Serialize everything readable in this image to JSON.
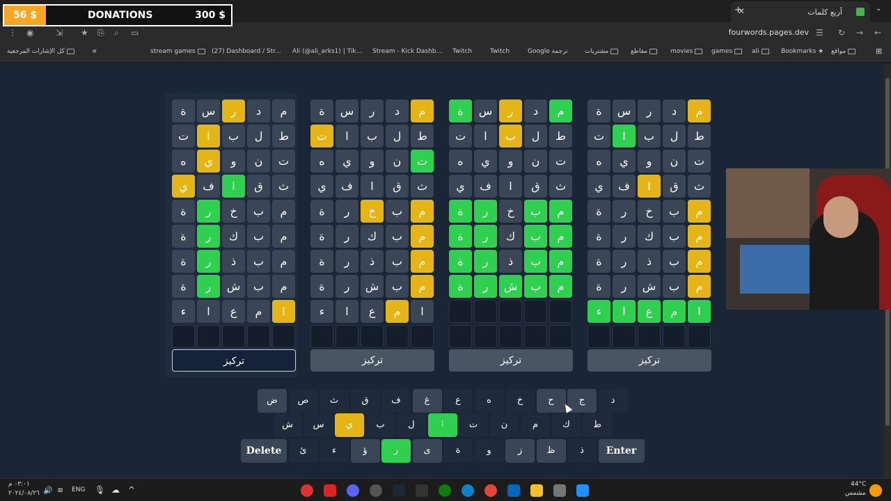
{
  "browser": {
    "tab_title": "أربع كلمات",
    "url": "fourwords.pages.dev",
    "new_tab": "+",
    "close": "✕",
    "bookmarks": [
      {
        "label": "مواقع"
      },
      {
        "label": "Bookmarks"
      },
      {
        "label": "ali"
      },
      {
        "label": "games"
      },
      {
        "label": "movies"
      },
      {
        "label": "مقاطع"
      },
      {
        "label": "مشتريات"
      },
      {
        "label": "Google ترجمة"
      },
      {
        "label": "Twitch"
      },
      {
        "label": "Twitch"
      },
      {
        "label": "Stream - Kick Dashb..."
      },
      {
        "label": "Ali (@ali_arks1) | Tik..."
      },
      {
        "label": "(27) Dashboard / Str..."
      },
      {
        "label": "stream games"
      }
    ],
    "all_bookmarks": "كل الإشارات المرجعية",
    "chevron": "«"
  },
  "donation": {
    "amount": "56 $",
    "label": "DONATIONS",
    "goal": "300 $"
  },
  "boards": [
    {
      "rows": [
        [
          [
            "ة",
            ""
          ],
          [
            "س",
            ""
          ],
          [
            "ر",
            "y"
          ],
          [
            "د",
            ""
          ],
          [
            "م",
            ""
          ]
        ],
        [
          [
            "ت",
            ""
          ],
          [
            "ا",
            "y"
          ],
          [
            "ب",
            ""
          ],
          [
            "ل",
            ""
          ],
          [
            "ط",
            ""
          ]
        ],
        [
          [
            "ه",
            ""
          ],
          [
            "ي",
            "y"
          ],
          [
            "و",
            ""
          ],
          [
            "ن",
            ""
          ],
          [
            "ت",
            ""
          ]
        ],
        [
          [
            "ي",
            "y"
          ],
          [
            "ف",
            ""
          ],
          [
            "ا",
            "g"
          ],
          [
            "ق",
            ""
          ],
          [
            "ث",
            ""
          ]
        ],
        [
          [
            "ة",
            ""
          ],
          [
            "ر",
            "g"
          ],
          [
            "خ",
            ""
          ],
          [
            "ب",
            ""
          ],
          [
            "م",
            ""
          ]
        ],
        [
          [
            "ة",
            ""
          ],
          [
            "ر",
            "g"
          ],
          [
            "ك",
            ""
          ],
          [
            "ب",
            ""
          ],
          [
            "م",
            ""
          ]
        ],
        [
          [
            "ة",
            ""
          ],
          [
            "ر",
            "g"
          ],
          [
            "ذ",
            ""
          ],
          [
            "ب",
            ""
          ],
          [
            "م",
            ""
          ]
        ],
        [
          [
            "ة",
            ""
          ],
          [
            "ر",
            "g"
          ],
          [
            "ش",
            ""
          ],
          [
            "ب",
            ""
          ],
          [
            "م",
            ""
          ]
        ],
        [
          [
            "ء",
            ""
          ],
          [
            "ا",
            ""
          ],
          [
            "ع",
            ""
          ],
          [
            "م",
            ""
          ],
          [
            "ا",
            "y"
          ]
        ],
        [
          [
            "",
            "e"
          ],
          [
            "",
            "e"
          ],
          [
            "",
            "e"
          ],
          [
            "",
            "e"
          ],
          [
            "",
            "e"
          ]
        ]
      ],
      "focus": "تركيز"
    },
    {
      "rows": [
        [
          [
            "ة",
            ""
          ],
          [
            "س",
            ""
          ],
          [
            "ر",
            ""
          ],
          [
            "د",
            ""
          ],
          [
            "م",
            "y"
          ]
        ],
        [
          [
            "ت",
            "y"
          ],
          [
            "ا",
            ""
          ],
          [
            "ب",
            ""
          ],
          [
            "ل",
            ""
          ],
          [
            "ط",
            ""
          ]
        ],
        [
          [
            "ه",
            ""
          ],
          [
            "ي",
            ""
          ],
          [
            "و",
            ""
          ],
          [
            "ن",
            ""
          ],
          [
            "ت",
            "g"
          ]
        ],
        [
          [
            "ي",
            ""
          ],
          [
            "ف",
            ""
          ],
          [
            "ا",
            ""
          ],
          [
            "ق",
            ""
          ],
          [
            "ث",
            ""
          ]
        ],
        [
          [
            "ة",
            ""
          ],
          [
            "ر",
            ""
          ],
          [
            "خ",
            "y"
          ],
          [
            "ب",
            ""
          ],
          [
            "م",
            "y"
          ]
        ],
        [
          [
            "ة",
            ""
          ],
          [
            "ر",
            ""
          ],
          [
            "ك",
            ""
          ],
          [
            "ب",
            ""
          ],
          [
            "م",
            "y"
          ]
        ],
        [
          [
            "ة",
            ""
          ],
          [
            "ر",
            ""
          ],
          [
            "ذ",
            ""
          ],
          [
            "ب",
            ""
          ],
          [
            "م",
            "y"
          ]
        ],
        [
          [
            "ة",
            ""
          ],
          [
            "ر",
            ""
          ],
          [
            "ش",
            ""
          ],
          [
            "ب",
            ""
          ],
          [
            "م",
            "y"
          ]
        ],
        [
          [
            "ء",
            ""
          ],
          [
            "ا",
            ""
          ],
          [
            "ع",
            ""
          ],
          [
            "م",
            "y"
          ],
          [
            "ا",
            ""
          ]
        ],
        [
          [
            "",
            "e"
          ],
          [
            "",
            "e"
          ],
          [
            "",
            "e"
          ],
          [
            "",
            "e"
          ],
          [
            "",
            "e"
          ]
        ]
      ],
      "focus": "تركيز"
    },
    {
      "rows": [
        [
          [
            "ة",
            "g"
          ],
          [
            "س",
            ""
          ],
          [
            "ر",
            "y"
          ],
          [
            "د",
            ""
          ],
          [
            "م",
            "g"
          ]
        ],
        [
          [
            "ت",
            ""
          ],
          [
            "ا",
            ""
          ],
          [
            "ب",
            "y"
          ],
          [
            "ل",
            ""
          ],
          [
            "ط",
            ""
          ]
        ],
        [
          [
            "ه",
            ""
          ],
          [
            "ي",
            ""
          ],
          [
            "و",
            ""
          ],
          [
            "ن",
            ""
          ],
          [
            "ت",
            ""
          ]
        ],
        [
          [
            "ي",
            ""
          ],
          [
            "ف",
            ""
          ],
          [
            "ا",
            ""
          ],
          [
            "ق",
            ""
          ],
          [
            "ث",
            ""
          ]
        ],
        [
          [
            "ة",
            "g"
          ],
          [
            "ر",
            "g"
          ],
          [
            "خ",
            ""
          ],
          [
            "ب",
            "g"
          ],
          [
            "م",
            "g"
          ]
        ],
        [
          [
            "ة",
            "g"
          ],
          [
            "ر",
            "g"
          ],
          [
            "ك",
            ""
          ],
          [
            "ب",
            "g"
          ],
          [
            "م",
            "g"
          ]
        ],
        [
          [
            "ة",
            "g"
          ],
          [
            "ر",
            "g"
          ],
          [
            "ذ",
            ""
          ],
          [
            "ب",
            "g"
          ],
          [
            "م",
            "g"
          ]
        ],
        [
          [
            "ة",
            "g"
          ],
          [
            "ر",
            "g"
          ],
          [
            "ش",
            "g"
          ],
          [
            "ب",
            "g"
          ],
          [
            "م",
            "g"
          ]
        ],
        [
          [
            "",
            "e"
          ],
          [
            "",
            "e"
          ],
          [
            "",
            "e"
          ],
          [
            "",
            "e"
          ],
          [
            "",
            "e"
          ]
        ],
        [
          [
            "",
            "e"
          ],
          [
            "",
            "e"
          ],
          [
            "",
            "e"
          ],
          [
            "",
            "e"
          ],
          [
            "",
            "e"
          ]
        ]
      ],
      "focus": "تركيز"
    },
    {
      "rows": [
        [
          [
            "ة",
            ""
          ],
          [
            "س",
            ""
          ],
          [
            "ر",
            ""
          ],
          [
            "د",
            ""
          ],
          [
            "م",
            "y"
          ]
        ],
        [
          [
            "ت",
            ""
          ],
          [
            "ا",
            "g"
          ],
          [
            "ب",
            ""
          ],
          [
            "ل",
            ""
          ],
          [
            "ط",
            ""
          ]
        ],
        [
          [
            "ه",
            ""
          ],
          [
            "ي",
            ""
          ],
          [
            "و",
            ""
          ],
          [
            "ن",
            ""
          ],
          [
            "ت",
            ""
          ]
        ],
        [
          [
            "ي",
            ""
          ],
          [
            "ف",
            ""
          ],
          [
            "ا",
            "y"
          ],
          [
            "ق",
            ""
          ],
          [
            "ث",
            ""
          ]
        ],
        [
          [
            "ة",
            ""
          ],
          [
            "ر",
            ""
          ],
          [
            "خ",
            ""
          ],
          [
            "ب",
            ""
          ],
          [
            "م",
            "y"
          ]
        ],
        [
          [
            "ة",
            ""
          ],
          [
            "ر",
            ""
          ],
          [
            "ك",
            ""
          ],
          [
            "ب",
            ""
          ],
          [
            "م",
            "y"
          ]
        ],
        [
          [
            "ة",
            ""
          ],
          [
            "ر",
            ""
          ],
          [
            "ذ",
            ""
          ],
          [
            "ب",
            ""
          ],
          [
            "م",
            "y"
          ]
        ],
        [
          [
            "ة",
            ""
          ],
          [
            "ر",
            ""
          ],
          [
            "ش",
            ""
          ],
          [
            "ب",
            ""
          ],
          [
            "م",
            "y"
          ]
        ],
        [
          [
            "ء",
            "g"
          ],
          [
            "ا",
            "g"
          ],
          [
            "ع",
            "g"
          ],
          [
            "م",
            "g"
          ],
          [
            "ا",
            "g"
          ]
        ],
        [
          [
            "",
            "e"
          ],
          [
            "",
            "e"
          ],
          [
            "",
            "e"
          ],
          [
            "",
            "e"
          ],
          [
            "",
            "e"
          ]
        ]
      ],
      "focus": "تركيز"
    }
  ],
  "keyboard": {
    "row1": [
      [
        "ض",
        "gray"
      ],
      [
        "ص",
        ""
      ],
      [
        "ث",
        ""
      ],
      [
        "ق",
        ""
      ],
      [
        "ف",
        ""
      ],
      [
        "غ",
        "gray"
      ],
      [
        "ع",
        ""
      ],
      [
        "ه",
        ""
      ],
      [
        "خ",
        ""
      ],
      [
        "ح",
        "gray"
      ],
      [
        "ج",
        "gray"
      ],
      [
        "د",
        ""
      ]
    ],
    "row2": [
      [
        "ش",
        ""
      ],
      [
        "س",
        ""
      ],
      [
        "ي",
        "y"
      ],
      [
        "ب",
        ""
      ],
      [
        "ل",
        ""
      ],
      [
        "ا",
        "g"
      ],
      [
        "ت",
        ""
      ],
      [
        "ن",
        ""
      ],
      [
        "م",
        ""
      ],
      [
        "ك",
        ""
      ],
      [
        "ط",
        ""
      ]
    ],
    "row3": [
      [
        "Delete",
        "wide"
      ],
      [
        "ئ",
        ""
      ],
      [
        "ء",
        ""
      ],
      [
        "ؤ",
        "gray"
      ],
      [
        "ر",
        "g"
      ],
      [
        "ى",
        "gray"
      ],
      [
        "ة",
        ""
      ],
      [
        "و",
        ""
      ],
      [
        "ز",
        "gray"
      ],
      [
        "ظ",
        "gray"
      ],
      [
        "ذ",
        ""
      ],
      [
        "Enter",
        "wide"
      ]
    ]
  },
  "taskbar": {
    "time": "٠٣:٠١ م",
    "date": "٢٠٢٤/٠٨/٢٦",
    "lang": "ENG",
    "temp": "44°C",
    "weather": "مشمس"
  }
}
